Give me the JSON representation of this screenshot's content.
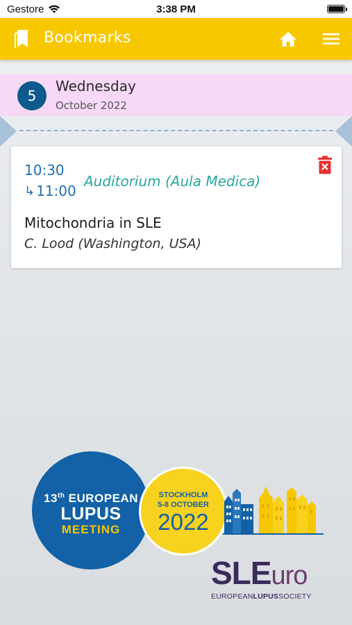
{
  "status_bar": {
    "carrier": "Gestore",
    "time": "3:38 PM"
  },
  "app_bar": {
    "title": "Bookmarks",
    "color": "#f7c800"
  },
  "day": {
    "number": "5",
    "weekday": "Wednesday",
    "month": "October 2022",
    "header_color": "#f7d9f7"
  },
  "session": {
    "start_time": "10:30",
    "end_time": "11:00",
    "location": "Auditorium (Aula Medica)",
    "title": "Mitochondria in SLE",
    "speaker": "C. Lood (Washington, USA)"
  },
  "logo": {
    "ordinal_number": "13",
    "ordinal_suffix": "th",
    "line1": "EUROPEAN",
    "line2": "LUPUS",
    "line3": "MEETING",
    "city": "STOCKHOLM",
    "dates": "5-8 OCTOBER",
    "year": "2022",
    "brand_sle": "SLE",
    "brand_uro": "uro",
    "brand_sub_1": "EUROPEAN",
    "brand_sub_2": "LUPUS",
    "brand_sub_3": "SOCIETY"
  },
  "icons": {
    "bookmark": "bookmark-icon",
    "home": "home-icon",
    "menu": "menu-icon",
    "delete": "delete-icon",
    "arrow": "return-arrow-icon"
  }
}
